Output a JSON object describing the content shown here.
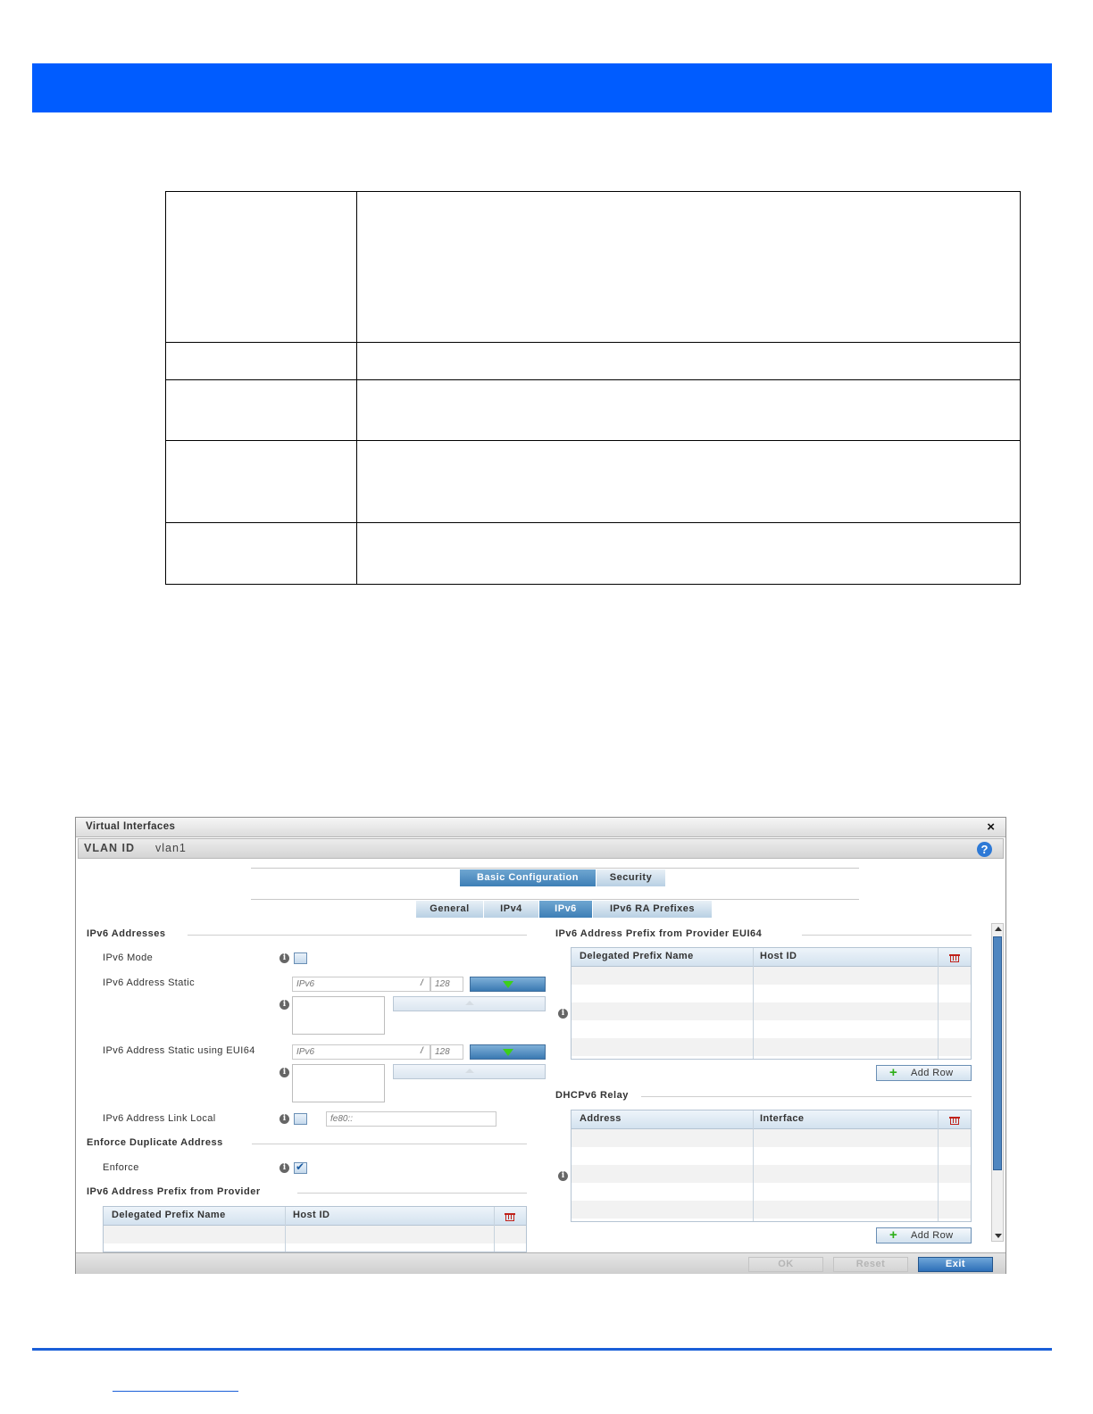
{
  "window": {
    "title": "Virtual Interfaces",
    "close_symbol": "×",
    "vlan_label": "VLAN ID",
    "vlan_value": "vlan1",
    "help_symbol": "?"
  },
  "top_tabs": [
    "Basic Configuration",
    "Security"
  ],
  "sub_tabs": [
    "General",
    "IPv4",
    "IPv6",
    "IPv6 RA Prefixes"
  ],
  "active_top_tab": "Basic Configuration",
  "active_sub_tab": "IPv6",
  "left": {
    "ipv6_addresses_title": "IPv6 Addresses",
    "ipv6_mode_label": "IPv6 Mode",
    "ipv6_mode_checked": false,
    "static_label": "IPv6 Address Static",
    "static_placeholder": "IPv6",
    "static_prefix_placeholder": "128",
    "eui64_label": "IPv6 Address Static using EUI64",
    "eui64_placeholder": "IPv6",
    "eui64_prefix_placeholder": "128",
    "link_local_label": "IPv6 Address Link Local",
    "link_local_placeholder": "fe80::",
    "link_local_checked": false,
    "enforce_title": "Enforce Duplicate Address",
    "enforce_label": "Enforce",
    "enforce_checked": true,
    "provider_title": "IPv6 Address Prefix from Provider",
    "provider_columns": [
      "Delegated Prefix Name",
      "Host ID"
    ]
  },
  "right": {
    "eui64_title": "IPv6 Address Prefix from Provider EUI64",
    "eui64_columns": [
      "Delegated Prefix Name",
      "Host ID"
    ],
    "add_row_label": "Add Row",
    "relay_title": "DHCPv6 Relay",
    "relay_columns": [
      "Address",
      "Interface"
    ],
    "add_row_label_2": "Add Row"
  },
  "footer": {
    "ok": "OK",
    "reset": "Reset",
    "exit": "Exit"
  },
  "colors": {
    "header_bar": "#005cff",
    "footer_rule": "#1a5fd8",
    "tab_active": "#3d7fb6"
  }
}
